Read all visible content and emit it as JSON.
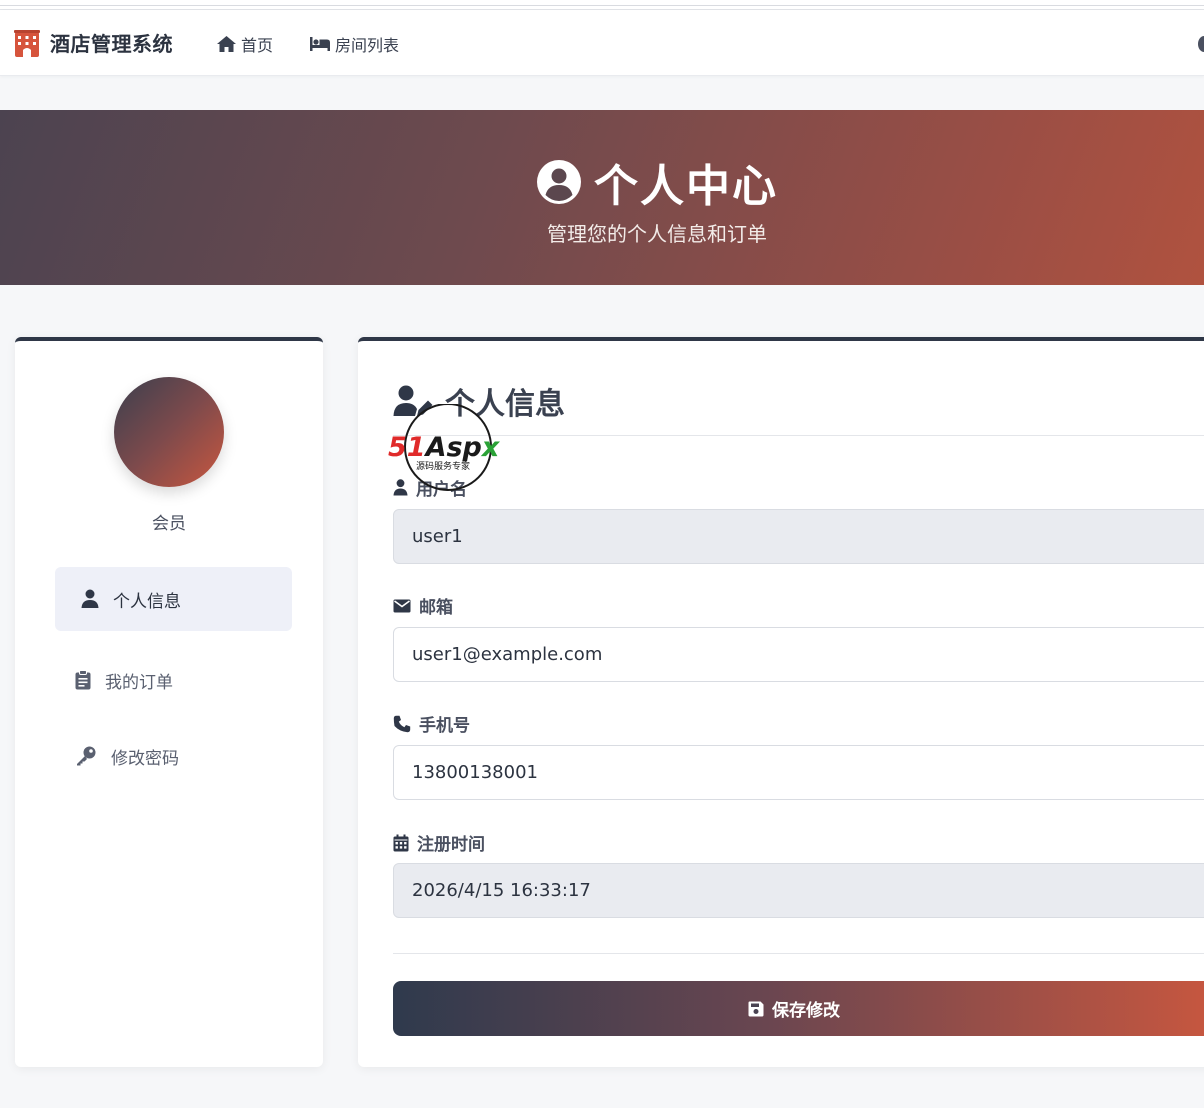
{
  "navbar": {
    "brand": "酒店管理系统",
    "links": [
      {
        "label": "首页",
        "icon": "home-icon"
      },
      {
        "label": "房间列表",
        "icon": "bed-icon"
      }
    ]
  },
  "hero": {
    "title": "个人中心",
    "subtitle": "管理您的个人信息和订单"
  },
  "sidebar": {
    "role": "会员",
    "items": [
      {
        "label": "个人信息",
        "icon": "user-icon",
        "active": true
      },
      {
        "label": "我的订单",
        "icon": "clipboard-icon",
        "active": false
      },
      {
        "label": "修改密码",
        "icon": "key-icon",
        "active": false
      }
    ]
  },
  "form": {
    "title": "个人信息",
    "fields": {
      "username": {
        "label": "用户名",
        "value": "user1",
        "readonly": true
      },
      "email": {
        "label": "邮箱",
        "value": "user1@example.com",
        "readonly": false
      },
      "phone": {
        "label": "手机号",
        "value": "13800138001",
        "readonly": false
      },
      "regtime": {
        "label": "注册时间",
        "value": "2026/4/15 16:33:17",
        "readonly": true
      }
    },
    "save_label": "保存修改"
  },
  "watermark": {
    "brand_red": "51",
    "brand_dark": "Asp",
    "brand_green": "x",
    "tagline": "源码服务专家"
  },
  "colors": {
    "primary_dark": "#2f3747",
    "accent": "#c9573f",
    "active_bg": "#eef0f8"
  }
}
